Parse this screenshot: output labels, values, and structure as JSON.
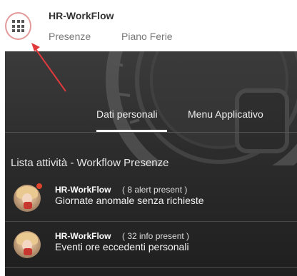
{
  "header": {
    "app_title": "HR-WorkFlow",
    "nav": [
      "Presenze",
      "Piano Ferie"
    ]
  },
  "tabs": [
    "Dati personali",
    "Menu Applicativo"
  ],
  "active_tab": "Dati personali",
  "section": {
    "title": "Lista attività - Workflow Presenze"
  },
  "activities": [
    {
      "app": "HR-WorkFlow",
      "count": "( 8 alert present )",
      "description": "Giornate anomale senza richieste",
      "has_alert_dot": true
    },
    {
      "app": "HR-WorkFlow",
      "count": "( 32 info present )",
      "description": "Eventi ore eccedenti personali",
      "has_alert_dot": false
    }
  ],
  "icons": {
    "apps_menu": "apps-grid-icon",
    "annotation": "red-arrow"
  },
  "colors": {
    "highlight_circle": "#e39a9a",
    "annotation_arrow": "#e0393c",
    "alert_dot": "#e0432b",
    "dark_background": "#2c2c2c"
  }
}
